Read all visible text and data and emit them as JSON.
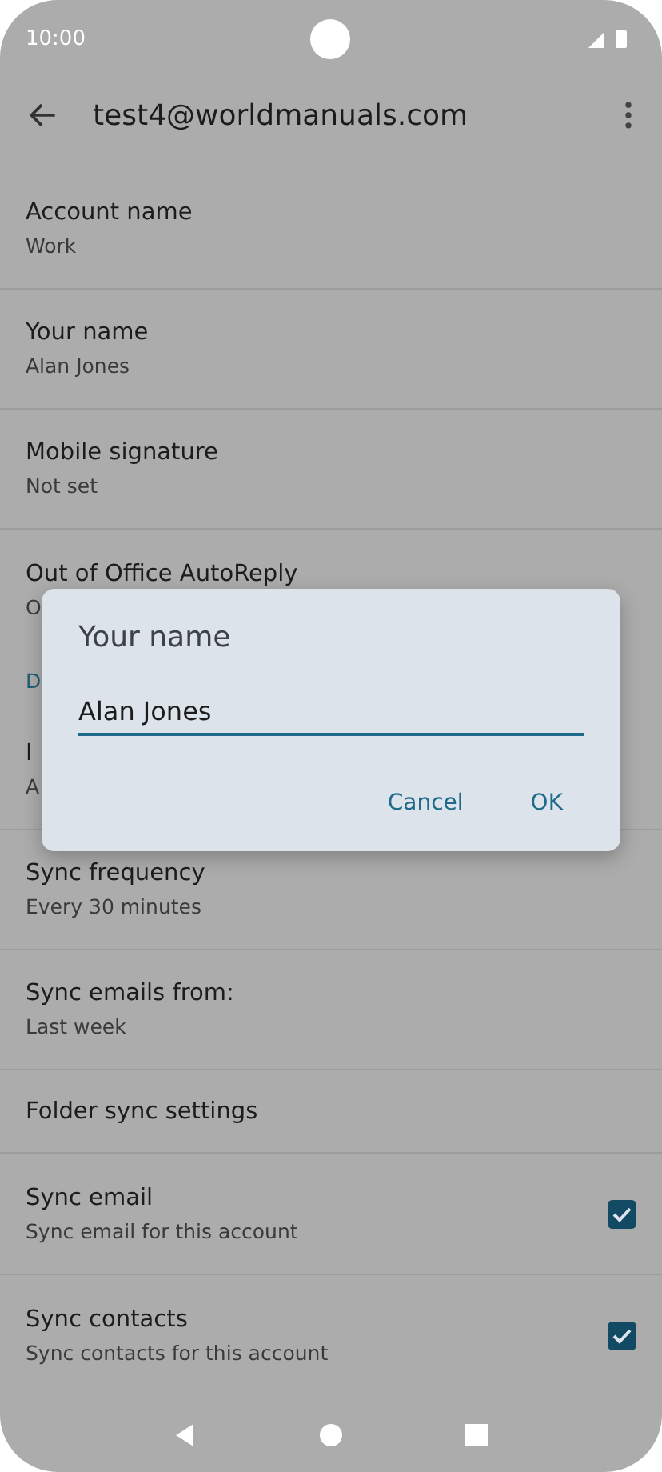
{
  "status_bar": {
    "time": "10:00"
  },
  "app_bar": {
    "title": "test4@worldmanuals.com"
  },
  "settings": [
    {
      "kind": "setting",
      "title": "Account name",
      "subtitle": "Work"
    },
    {
      "kind": "setting",
      "title": "Your name",
      "subtitle": "Alan Jones"
    },
    {
      "kind": "setting",
      "title": "Mobile signature",
      "subtitle": "Not set"
    },
    {
      "kind": "setting",
      "title": "Out of Office AutoReply",
      "subtitle": "O"
    },
    {
      "kind": "header",
      "title": "D"
    },
    {
      "kind": "setting",
      "title": "I",
      "subtitle": "A"
    },
    {
      "kind": "setting",
      "title": "Sync frequency",
      "subtitle": "Every 30 minutes"
    },
    {
      "kind": "setting",
      "title": "Sync emails from:",
      "subtitle": "Last week"
    },
    {
      "kind": "setting",
      "title": "Folder sync settings"
    },
    {
      "kind": "checkbox",
      "title": "Sync email",
      "subtitle": "Sync email for this account",
      "checked": true
    },
    {
      "kind": "checkbox",
      "title": "Sync contacts",
      "subtitle": "Sync contacts for this account",
      "checked": true
    }
  ],
  "dialog": {
    "title": "Your name",
    "value": "Alan Jones",
    "buttons": [
      "Cancel",
      "OK"
    ]
  }
}
